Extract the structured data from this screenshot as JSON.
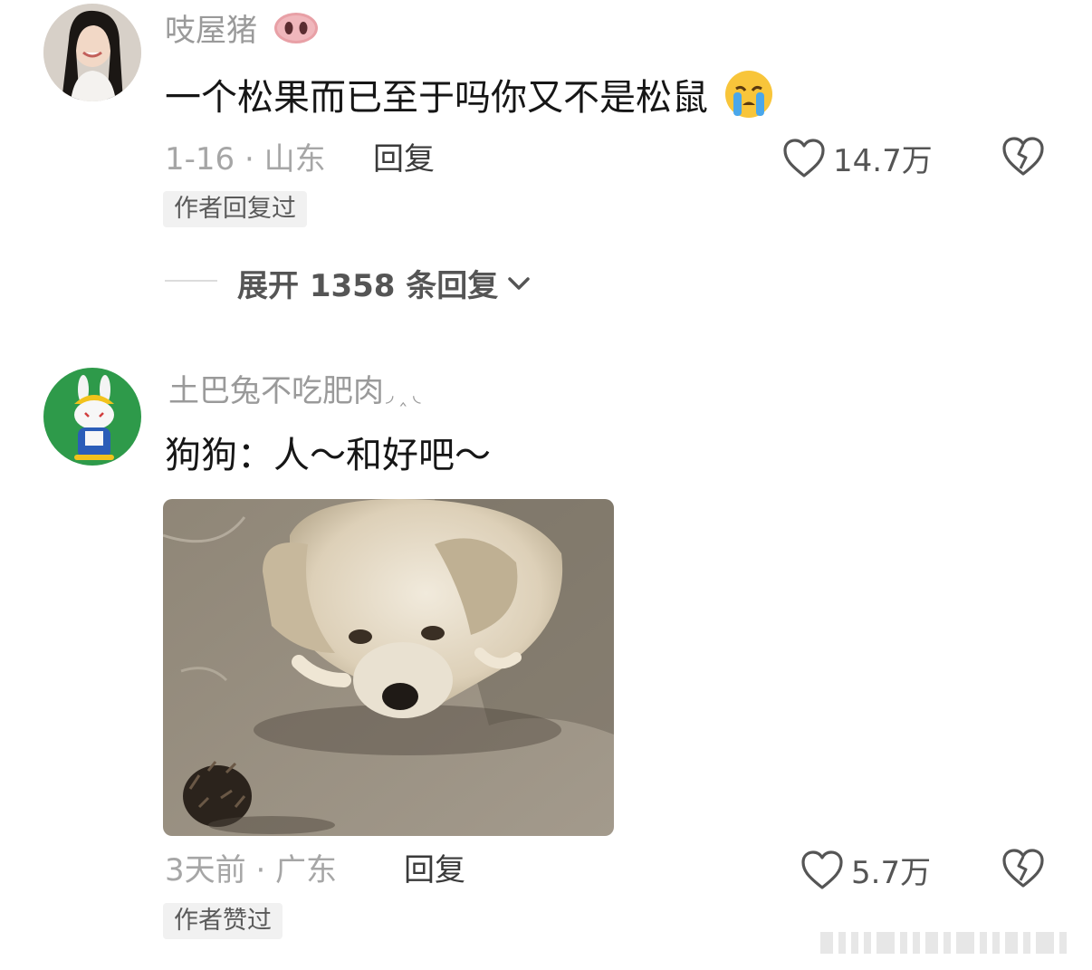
{
  "comments": [
    {
      "username": "吱屋猪",
      "username_emoji": "pig-nose",
      "text": "一个松果而已至于吗你又不是松鼠",
      "text_emoji": "crying-face",
      "date_location": "1-16 · 山东",
      "reply_label": "回复",
      "like_count": "14.7万",
      "tag": "作者回复过",
      "expand_label": "展开 1358 条回复"
    },
    {
      "username": "土巴兔不吃肥肉",
      "username_suffix": "◞ ‸ ◟",
      "text": "狗狗：人～和好吧～",
      "date_location": "3天前 · 广东",
      "reply_label": "回复",
      "like_count": "5.7万",
      "tag": "作者赞过",
      "image": "dog-and-pinecone-photo"
    }
  ],
  "colors": {
    "username": "#9a9a9a",
    "meta": "#a6a6a6",
    "text": "#161616",
    "tag_bg": "#f1f1f1"
  }
}
